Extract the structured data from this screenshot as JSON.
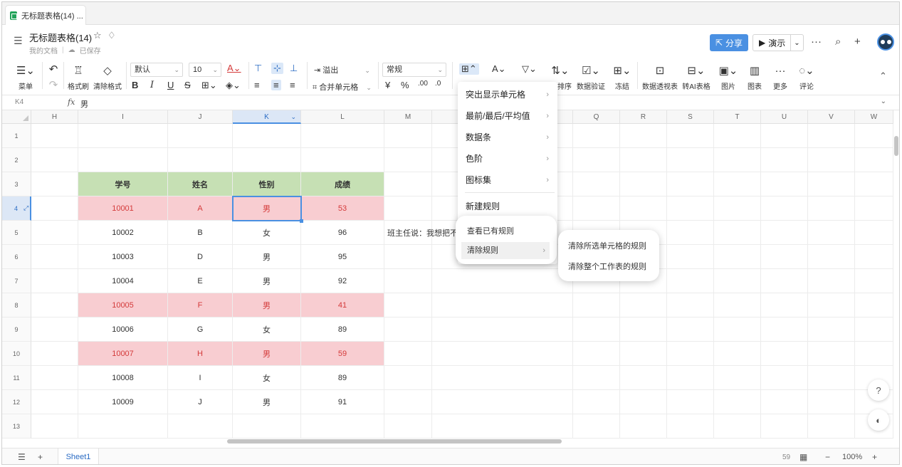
{
  "browser_tab": {
    "title": "无标题表格(14) ..."
  },
  "header": {
    "title": "无标题表格(14)",
    "location": "我的文档",
    "save_status": "已保存",
    "share_label": "分享",
    "present_label": "演示"
  },
  "toolbar": {
    "menu_label": "菜单",
    "format_painter_label": "格式刷",
    "clear_format_label": "清除格式",
    "font_name": "默认",
    "font_size": "10",
    "overflow_label": "溢出",
    "merge_label": "合并单元格",
    "number_format": "常规",
    "sort_label": "排序",
    "data_validation_label": "数据验证",
    "freeze_label": "冻结",
    "pivot_label": "数据透视表",
    "ai_table_label": "转AI表格",
    "image_label": "图片",
    "chart_label": "图表",
    "more_label": "更多",
    "comment_label": "评论"
  },
  "formula_bar": {
    "cell_ref": "K4",
    "fx_label": "fx",
    "value": "男"
  },
  "columns": [
    "H",
    "I",
    "J",
    "K",
    "L",
    "M",
    "N",
    "Q",
    "R",
    "S",
    "T",
    "U",
    "V",
    "W"
  ],
  "active_column": "K",
  "rows": [
    "1",
    "2",
    "3",
    "4",
    "5",
    "6",
    "7",
    "8",
    "9",
    "10",
    "11",
    "12",
    "13"
  ],
  "active_row": "4",
  "table": {
    "headers": [
      "学号",
      "姓名",
      "性别",
      "成绩"
    ],
    "records": [
      [
        "10001",
        "A",
        "男",
        "53"
      ],
      [
        "10002",
        "B",
        "女",
        "96"
      ],
      [
        "10003",
        "D",
        "男",
        "95"
      ],
      [
        "10004",
        "E",
        "男",
        "92"
      ],
      [
        "10005",
        "F",
        "男",
        "41"
      ],
      [
        "10006",
        "G",
        "女",
        "89"
      ],
      [
        "10007",
        "H",
        "男",
        "59"
      ],
      [
        "10008",
        "I",
        "女",
        "89"
      ],
      [
        "10009",
        "J",
        "男",
        "91"
      ]
    ],
    "highlighted_record_indices": [
      0,
      4,
      6
    ]
  },
  "note_text": "班主任说：我想把不",
  "colors": {
    "header_fill": "#c6e0b4",
    "highlight_fill": "#f8cdd1",
    "highlight_text": "#d43a3a",
    "accent": "#4a90e2"
  },
  "cf_menu": {
    "items": [
      "突出显示单元格",
      "最前/最后/平均值",
      "数据条",
      "色阶",
      "图标集",
      "新建规则"
    ],
    "inset_items": [
      "查看已有规则",
      "清除规则"
    ],
    "submenu_items": [
      "清除所选单元格的规则",
      "清除整个工作表的规则"
    ]
  },
  "statusbar": {
    "sheet_name": "Sheet1",
    "count": "59",
    "zoom": "100%"
  }
}
